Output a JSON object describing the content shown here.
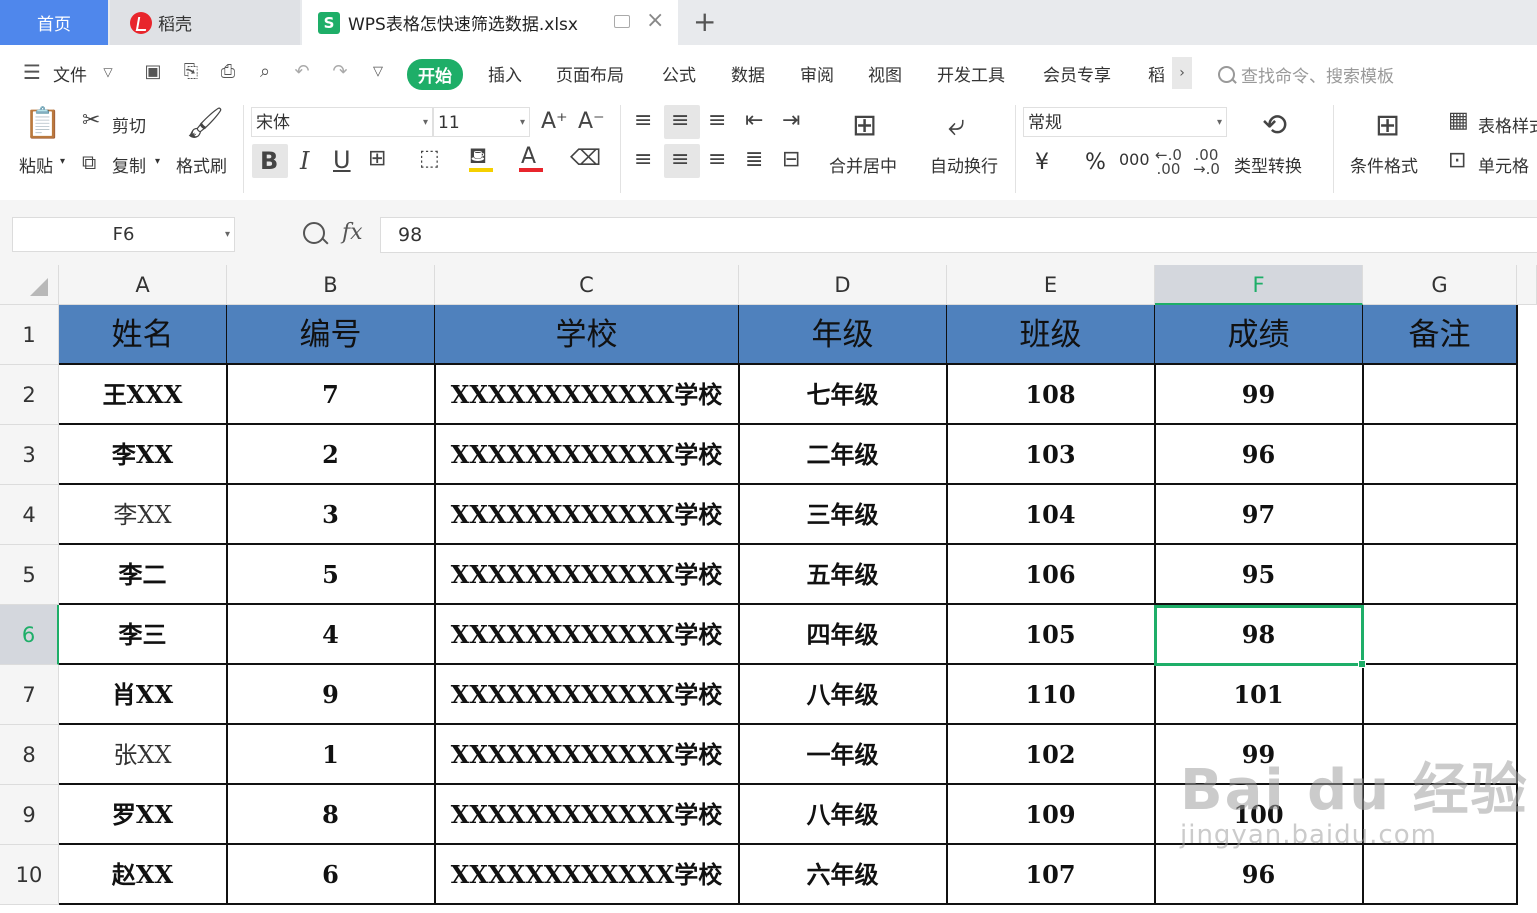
{
  "tabs": {
    "home": "首页",
    "daoke": "稻壳",
    "file": "WPS表格怎快速筛选数据.xlsx",
    "file_icon": "S"
  },
  "menu": {
    "file": "文件",
    "items": [
      "开始",
      "插入",
      "页面布局",
      "公式",
      "数据",
      "审阅",
      "视图",
      "开发工具",
      "会员专享",
      "稻"
    ],
    "search_placeholder": "查找命令、搜索模板"
  },
  "ribbon": {
    "paste": "粘贴",
    "cut": "剪切",
    "copy": "复制",
    "format_painter": "格式刷",
    "font_name": "宋体",
    "font_size": "11",
    "merge_center": "合并居中",
    "wrap_text": "自动换行",
    "number_format": "常规",
    "type_convert": "类型转换",
    "cond_format": "条件格式",
    "table_style": "表格样式",
    "cell_style": "单元格",
    "currency": "¥",
    "percent": "%",
    "thousands": "000"
  },
  "formula_bar": {
    "name_box": "F6",
    "fx": "fx",
    "value": "98"
  },
  "columns": [
    "A",
    "B",
    "C",
    "D",
    "E",
    "F",
    "G"
  ],
  "rows": [
    "1",
    "2",
    "3",
    "4",
    "5",
    "6",
    "7",
    "8",
    "9",
    "10"
  ],
  "sheet": {
    "header": [
      "姓名",
      "编号",
      "学校",
      "年级",
      "班级",
      "成绩",
      "备注"
    ],
    "data": [
      [
        "王XXX",
        "7",
        "XXXXXXXXXXXX学校",
        "七年级",
        "108",
        "99",
        ""
      ],
      [
        "李XX",
        "2",
        "XXXXXXXXXXXX学校",
        "二年级",
        "103",
        "96",
        ""
      ],
      [
        "李XX",
        "3",
        "XXXXXXXXXXXX学校",
        "三年级",
        "104",
        "97",
        ""
      ],
      [
        "李二",
        "5",
        "XXXXXXXXXXXX学校",
        "五年级",
        "106",
        "95",
        ""
      ],
      [
        "李三",
        "4",
        "XXXXXXXXXXXX学校",
        "四年级",
        "105",
        "98",
        ""
      ],
      [
        "肖XX",
        "9",
        "XXXXXXXXXXXX学校",
        "八年级",
        "110",
        "101",
        ""
      ],
      [
        "张XX",
        "1",
        "XXXXXXXXXXXX学校",
        "一年级",
        "102",
        "99",
        ""
      ],
      [
        "罗XX",
        "8",
        "XXXXXXXXXXXX学校",
        "八年级",
        "109",
        "100",
        ""
      ],
      [
        "赵XX",
        "6",
        "XXXXXXXXXXXX学校",
        "六年级",
        "107",
        "96",
        ""
      ]
    ],
    "selected_cell": "F6",
    "header_fill": "#4f81bd",
    "accent": "#1eae68"
  },
  "watermark": {
    "main": "Bai du 经验",
    "sub": "jingyan.baidu.com"
  }
}
